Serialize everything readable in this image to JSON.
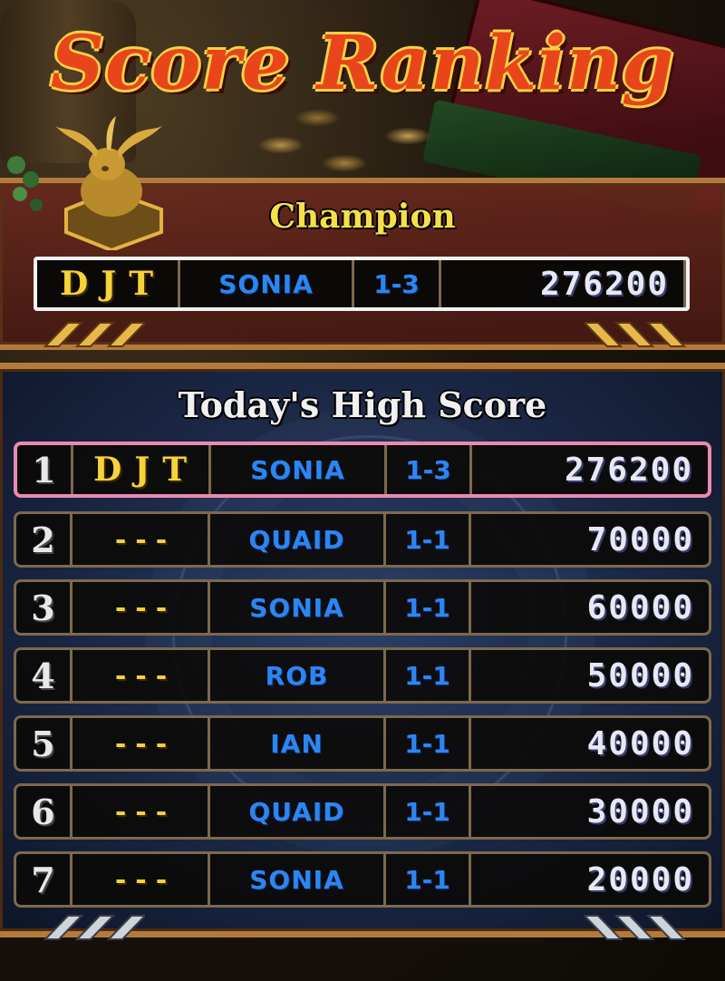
{
  "title": "Score Ranking",
  "champion": {
    "label": "Champion",
    "initials": "DJT",
    "name": "SONIA",
    "stage": "1-3",
    "score": "276200"
  },
  "high_score": {
    "label": "Today's High Score",
    "rows": [
      {
        "rank": "1",
        "initials": "DJT",
        "name": "SONIA",
        "stage": "1-3",
        "score": "276200"
      },
      {
        "rank": "2",
        "initials": "---",
        "name": "QUAID",
        "stage": "1-1",
        "score": "70000"
      },
      {
        "rank": "3",
        "initials": "---",
        "name": "SONIA",
        "stage": "1-1",
        "score": "60000"
      },
      {
        "rank": "4",
        "initials": "---",
        "name": "ROB",
        "stage": "1-1",
        "score": "50000"
      },
      {
        "rank": "5",
        "initials": "---",
        "name": "IAN",
        "stage": "1-1",
        "score": "40000"
      },
      {
        "rank": "6",
        "initials": "---",
        "name": "QUAID",
        "stage": "1-1",
        "score": "30000"
      },
      {
        "rank": "7",
        "initials": "---",
        "name": "SONIA",
        "stage": "1-1",
        "score": "20000"
      }
    ]
  },
  "colors": {
    "title": "#e8451b",
    "champion_label": "#f5e04a",
    "initials": "#f5d33a",
    "name": "#2c86f2",
    "score": "#e6e8f5",
    "highlight_border": "#e98bb1"
  }
}
